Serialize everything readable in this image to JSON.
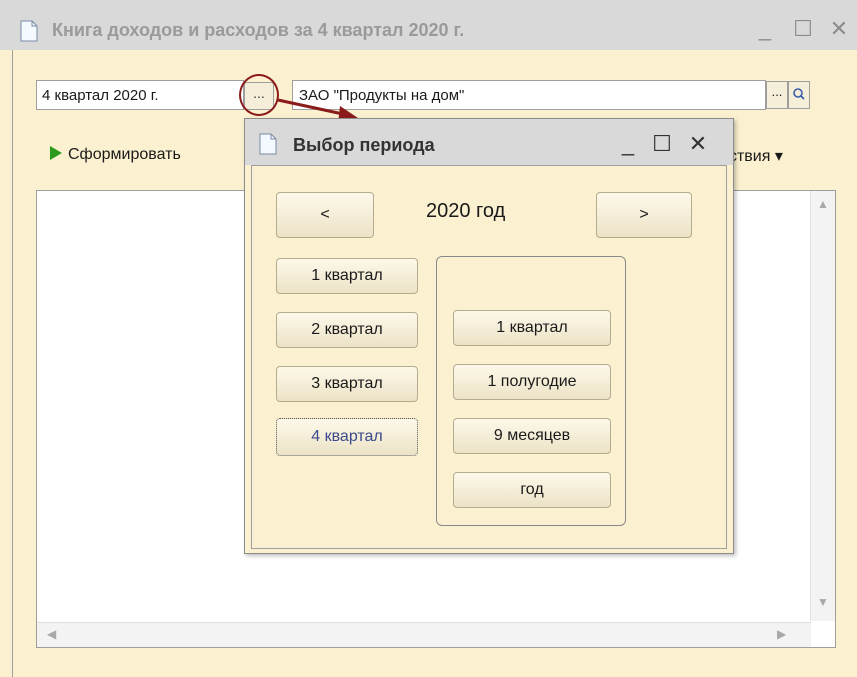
{
  "window": {
    "title": "Книга доходов и расходов за 4 квартал 2020 г.",
    "controls": {
      "minimize": "_",
      "maximize": "☐",
      "close": "✕"
    }
  },
  "header": {
    "period_value": "4 квартал 2020 г.",
    "period_select_label": "...",
    "organization_value": "ЗАО \"Продукты на дом\"",
    "organization_select_label": "..."
  },
  "toolbar": {
    "generate_label": "Сформировать",
    "actions_label": "йствия ▾"
  },
  "dialog": {
    "title": "Выбор периода",
    "controls": {
      "minimize": "_",
      "maximize": "☐",
      "close": "✕"
    },
    "prev_label": "<",
    "next_label": ">",
    "year_label": "2020 год",
    "quarters": [
      "1 квартал",
      "2 квартал",
      "3 квартал",
      "4 квартал"
    ],
    "selected_quarter": "4 квартал",
    "cumulative": [
      "1 квартал",
      "1 полугодие",
      "9 месяцев",
      "год"
    ]
  },
  "colors": {
    "window_bg": "#fbf1d0",
    "title_bar": "#d9d9d9",
    "callout_red": "#8b1a1a",
    "generate_icon": "#2c9a1c"
  }
}
